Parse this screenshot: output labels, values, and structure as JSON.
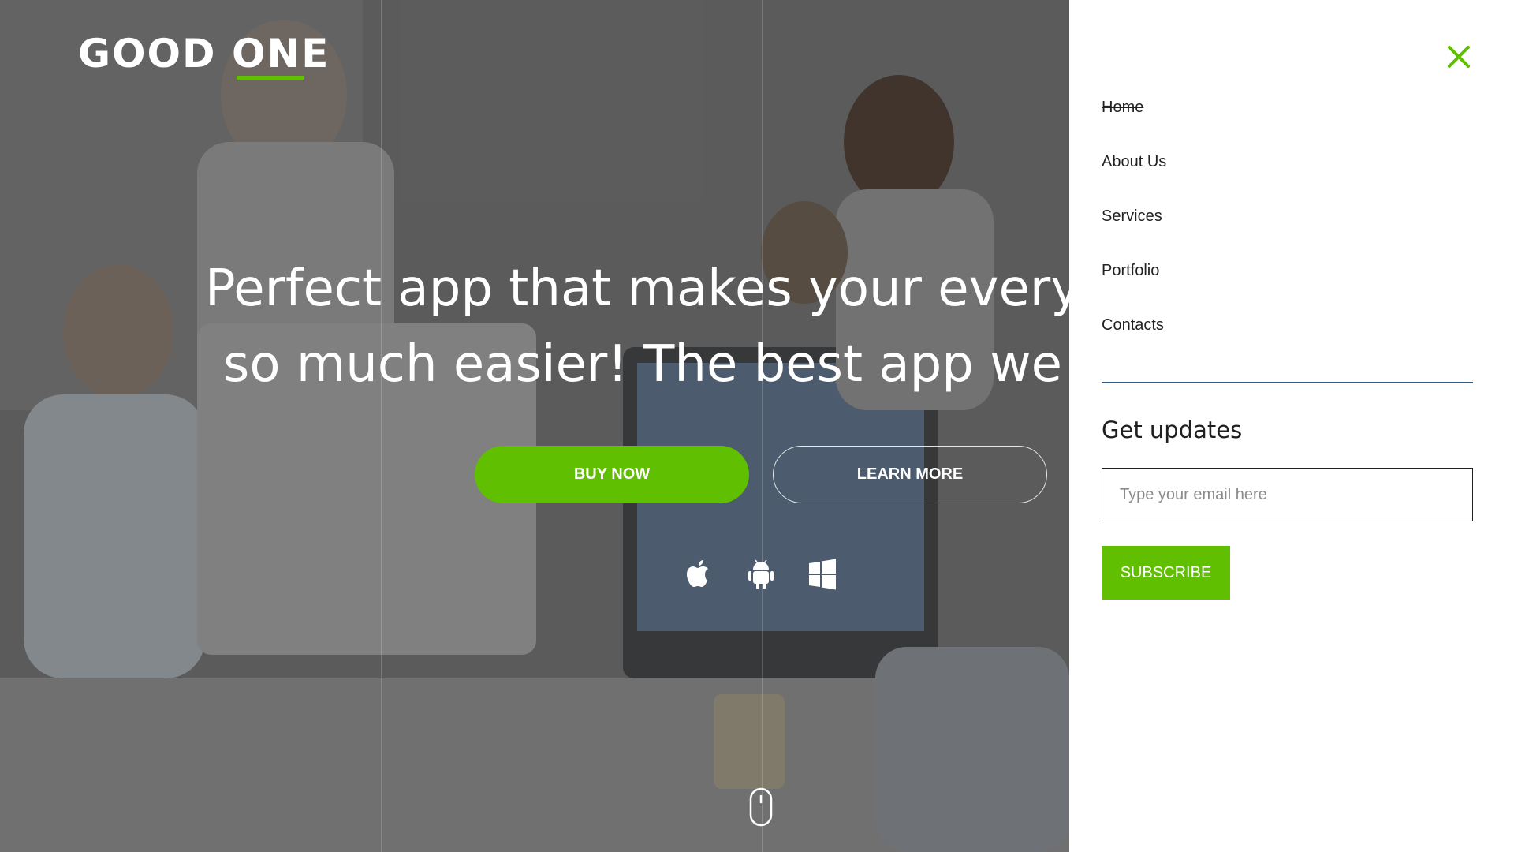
{
  "brand": {
    "logo_text": "GOOD ONE",
    "accent_color": "#5fbf00"
  },
  "hero": {
    "headline_line1": "Perfect app that makes your every",
    "headline_line2": "so much easier! The best app we",
    "buy_label": "BUY NOW",
    "learn_label": "LEARN MORE",
    "platform_icons": [
      "apple-icon",
      "android-icon",
      "windows-icon"
    ],
    "scroll_icon": "mouse-icon"
  },
  "panel": {
    "close_icon": "close-icon",
    "menu": [
      {
        "label": "Home",
        "active": true
      },
      {
        "label": "About Us",
        "active": false
      },
      {
        "label": "Services",
        "active": false
      },
      {
        "label": "Portfolio",
        "active": false
      },
      {
        "label": "Contacts",
        "active": false
      }
    ],
    "updates_title": "Get updates",
    "email_placeholder": "Type your email here",
    "subscribe_label": "SUBSCRIBE"
  }
}
